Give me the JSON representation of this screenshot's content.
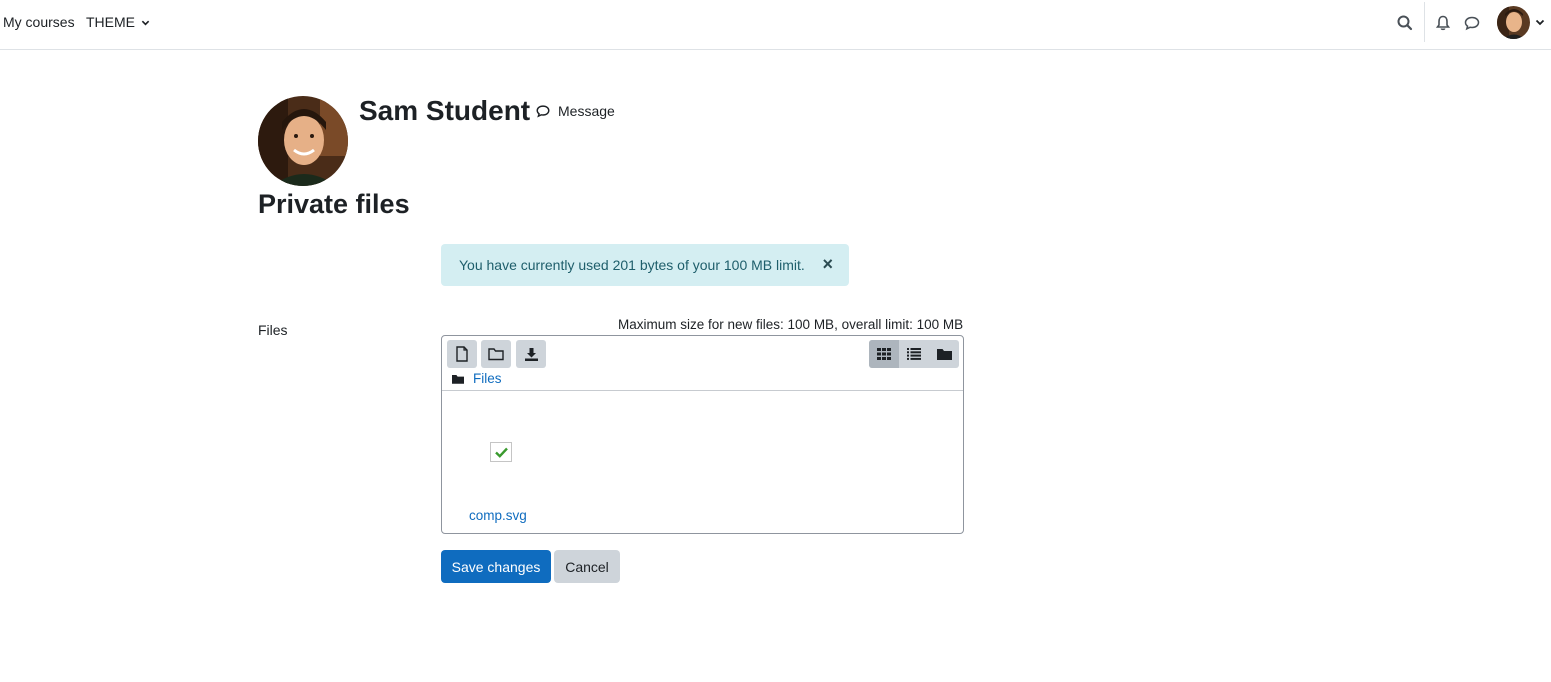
{
  "navbar": {
    "my_courses": "My courses",
    "theme": "THEME",
    "icons": [
      "search-icon",
      "bell-icon",
      "chat-icon",
      "chevron-down-icon"
    ]
  },
  "profile": {
    "name": "Sam Student",
    "message_label": "Message"
  },
  "page": {
    "title": "Private files"
  },
  "alert": {
    "text": "You have currently used 201 bytes of your 100 MB limit.",
    "close": "×"
  },
  "form": {
    "files_label": "Files",
    "max_size_text": "Maximum size for new files: 100 MB, overall limit: 100 MB"
  },
  "filemanager": {
    "path_label": "Files",
    "files": [
      {
        "name": "comp.svg"
      }
    ]
  },
  "buttons": {
    "save": "Save changes",
    "cancel": "Cancel"
  },
  "colors": {
    "primary": "#0f6cbf",
    "alert_bg": "#d4eef2",
    "alert_text": "#1e5e6b",
    "secondary_btn": "#ced4da"
  }
}
